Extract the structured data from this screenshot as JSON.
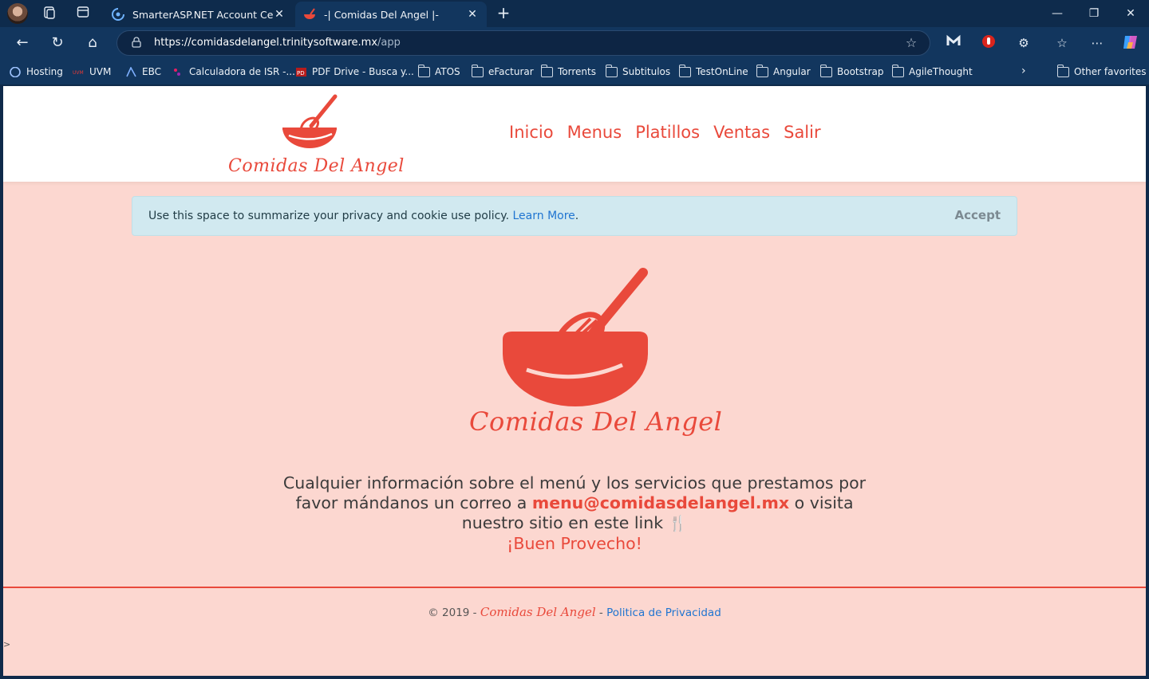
{
  "browser": {
    "tabs": [
      {
        "title": "SmarterASP.NET Account Center",
        "close": "✕"
      },
      {
        "title": "-| Comidas Del Angel |-",
        "close": "✕"
      }
    ],
    "new_tab": "+",
    "window": {
      "minimize": "—",
      "restore": "❐",
      "close": "✕"
    },
    "url": {
      "base": "https://comidasdelangel.trinitysoftware.mx",
      "path": "/app"
    },
    "favorites": [
      {
        "label": "Hosting"
      },
      {
        "label": "UVM"
      },
      {
        "label": "EBC"
      },
      {
        "label": "Calculadora de ISR -..."
      },
      {
        "label": "PDF Drive - Busca y..."
      },
      {
        "label": "ATOS"
      },
      {
        "label": "eFacturar"
      },
      {
        "label": "Torrents"
      },
      {
        "label": "Subtitulos"
      },
      {
        "label": "TestOnLine"
      },
      {
        "label": "Angular"
      },
      {
        "label": "Bootstrap"
      },
      {
        "label": "AgileThought"
      }
    ],
    "other_favorites": "Other favorites"
  },
  "site": {
    "brand": "Comidas Del Angel",
    "nav": [
      "Inicio",
      "Menus",
      "Platillos",
      "Ventas",
      "Salir"
    ],
    "cookie": {
      "text": "Use this space to summarize your privacy and cookie use policy.",
      "link": "Learn More",
      "period": ".",
      "accept": "Accept"
    },
    "info": {
      "line1": "Cualquier información sobre el menú y los servicios que prestamos por",
      "line2_pre": "favor mándanos un correo a",
      "email": "menu@comidasdelangel.mx",
      "line2_post": "o visita",
      "line3": "nuestro sitio en este link",
      "closing": "¡Buen Provecho!"
    },
    "footer": {
      "copyright": "© 2019 -",
      "brand": "Comidas Del Angel",
      "sep": "-",
      "privacy": "Politica de Privacidad"
    },
    "stray": ">"
  },
  "colors": {
    "accent": "#e9493b",
    "page_bg": "#fcd7d0",
    "cookie_bg": "#d1e9f0",
    "link": "#2075d1"
  }
}
